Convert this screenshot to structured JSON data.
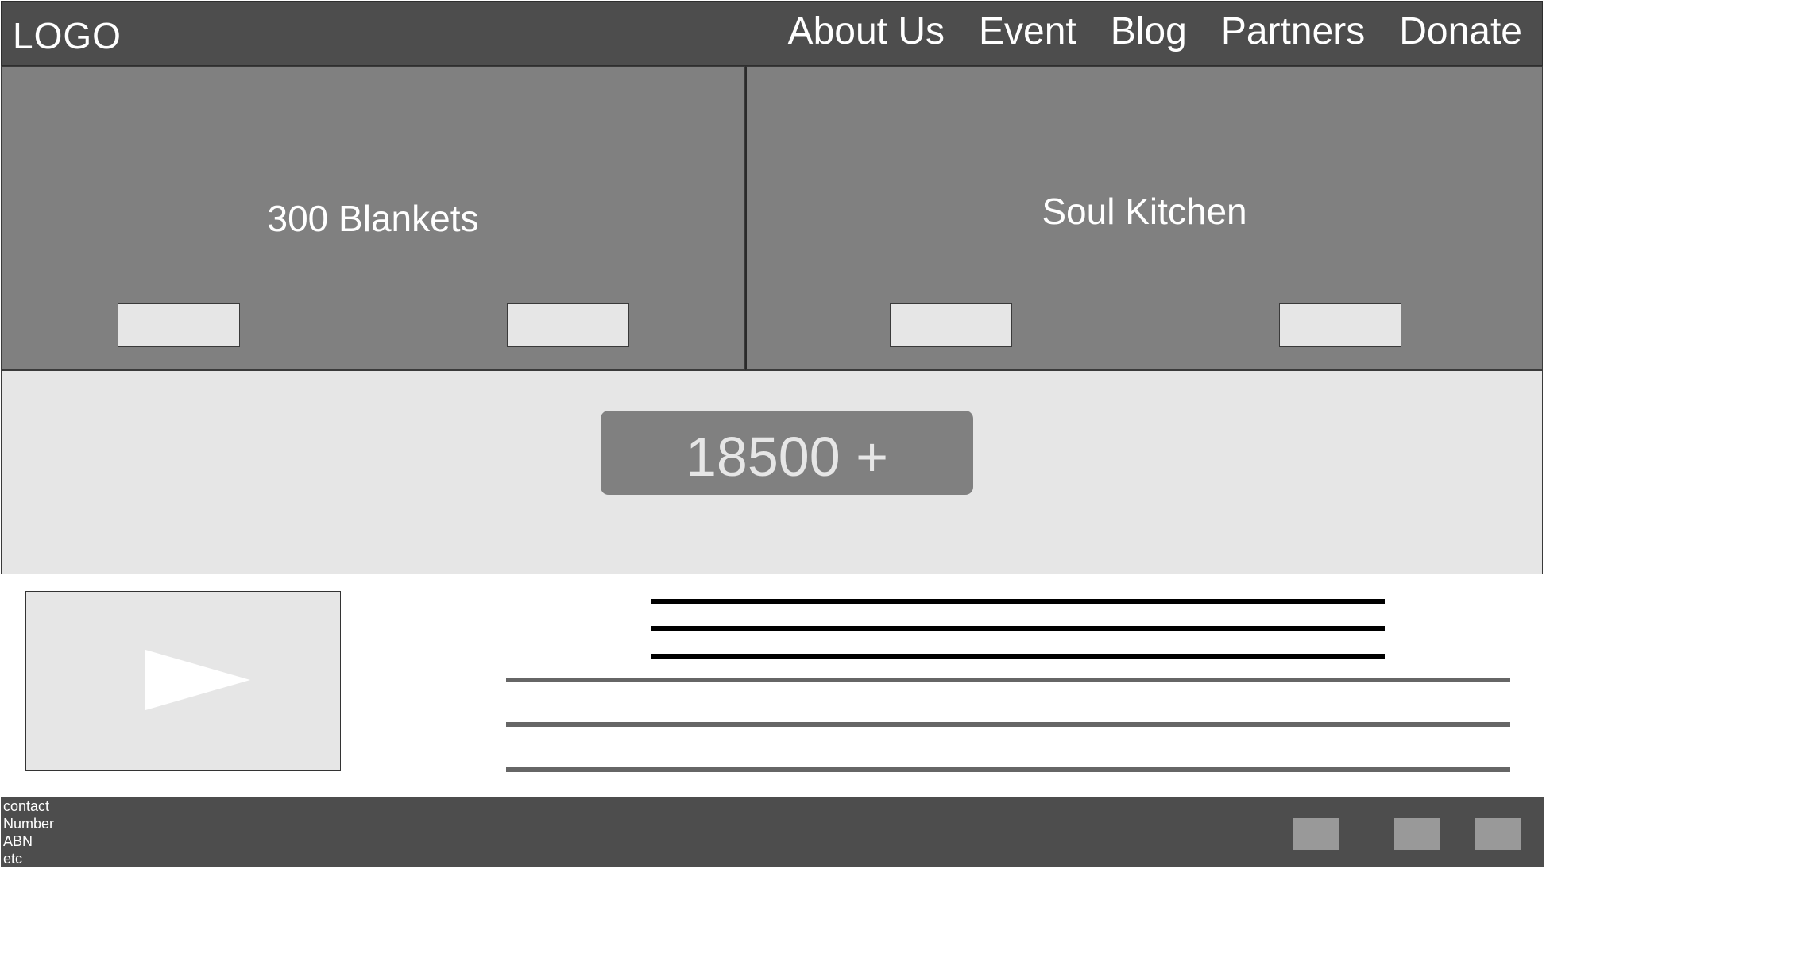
{
  "header": {
    "logo": "LOGO",
    "nav": [
      "About Us",
      "Event",
      "Blog",
      "Partners",
      "Donate"
    ]
  },
  "hero": {
    "left_title": "300 Blankets",
    "right_title": "Soul Kitchen"
  },
  "stats": {
    "count": "18500 +"
  },
  "footer": {
    "lines": [
      "contact",
      "Number",
      "ABN",
      "etc"
    ]
  },
  "colors": {
    "header_bg": "#4d4d4d",
    "panel_bg": "#808080",
    "light_bg": "#e6e6e6",
    "footer_bg": "#4d4d4d",
    "social_bg": "#999999"
  },
  "icons": {
    "video": "play-icon"
  }
}
